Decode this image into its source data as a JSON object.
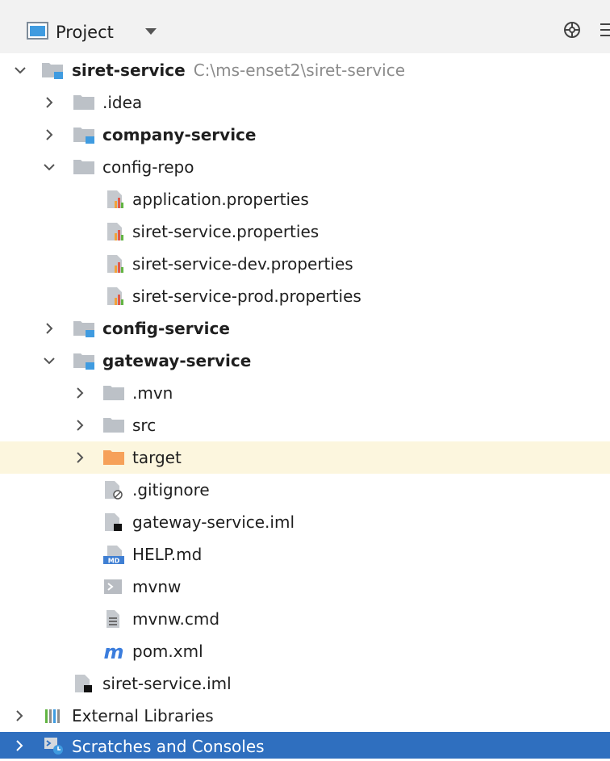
{
  "header": {
    "title": "Project",
    "icons": [
      "project-view-icon",
      "dropdown-caret-icon",
      "locate-target-icon",
      "more-options-icon"
    ]
  },
  "tree": {
    "root": {
      "label": "siret-service",
      "path": "C:\\ms-enset2\\siret-service"
    },
    "idea": {
      "label": ".idea"
    },
    "company_service": {
      "label": "company-service"
    },
    "config_repo": {
      "label": "config-repo"
    },
    "application_properties": {
      "label": "application.properties"
    },
    "siret_properties": {
      "label": "siret-service.properties"
    },
    "siret_dev_properties": {
      "label": "siret-service-dev.properties"
    },
    "siret_prod_properties": {
      "label": "siret-service-prod.properties"
    },
    "config_service": {
      "label": "config-service"
    },
    "gateway_service": {
      "label": "gateway-service"
    },
    "mvn": {
      "label": ".mvn"
    },
    "src": {
      "label": "src"
    },
    "target": {
      "label": "target"
    },
    "gitignore": {
      "label": ".gitignore"
    },
    "gateway_iml": {
      "label": "gateway-service.iml"
    },
    "help_md": {
      "label": "HELP.md"
    },
    "mvnw": {
      "label": "mvnw"
    },
    "mvnw_cmd": {
      "label": "mvnw.cmd"
    },
    "pom_xml": {
      "label": "pom.xml"
    },
    "siret_iml": {
      "label": "siret-service.iml"
    },
    "external_libraries": {
      "label": "External Libraries"
    },
    "scratches": {
      "label": "Scratches and Consoles"
    }
  },
  "colors": {
    "header_bg": "#f2f2f2",
    "highlight_bg": "#fcf6de",
    "selected_bg": "#2f6fbf",
    "folder_gray": "#bcc1c7",
    "module_blue": "#3f9be0",
    "excluded_orange": "#f6a15a"
  }
}
